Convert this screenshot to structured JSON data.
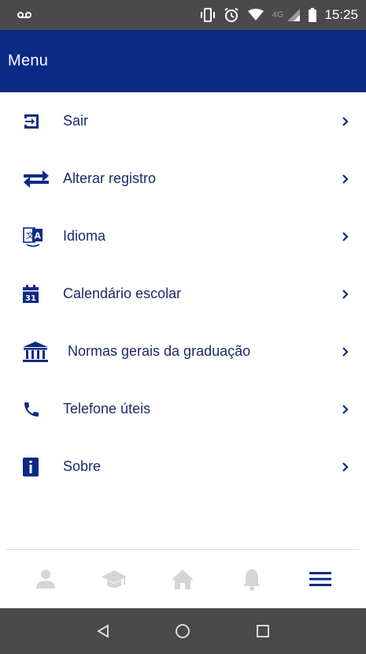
{
  "status_bar": {
    "time": "15:25",
    "network": "4G"
  },
  "app_bar": {
    "title": "Menu"
  },
  "menu": {
    "items": [
      {
        "label": "Sair",
        "icon": "logout-icon"
      },
      {
        "label": "Alterar registro",
        "icon": "swap-icon"
      },
      {
        "label": "Idioma",
        "icon": "translate-icon"
      },
      {
        "label": "Calendário escolar",
        "icon": "calendar-icon"
      },
      {
        "label": "Normas gerais da graduação",
        "icon": "institution-icon"
      },
      {
        "label": "Telefone úteis",
        "icon": "phone-icon"
      },
      {
        "label": "Sobre",
        "icon": "info-icon"
      }
    ]
  },
  "tab_bar": {
    "tabs": [
      "profile-icon",
      "graduation-cap-icon",
      "home-icon",
      "bell-icon",
      "menu-icon"
    ],
    "active": "menu-icon"
  },
  "colors": {
    "primary": "#0b2a84",
    "text": "#1a2a6c",
    "inactive_icon": "#d5d5d5",
    "system_bar": "#4a4a4a"
  }
}
